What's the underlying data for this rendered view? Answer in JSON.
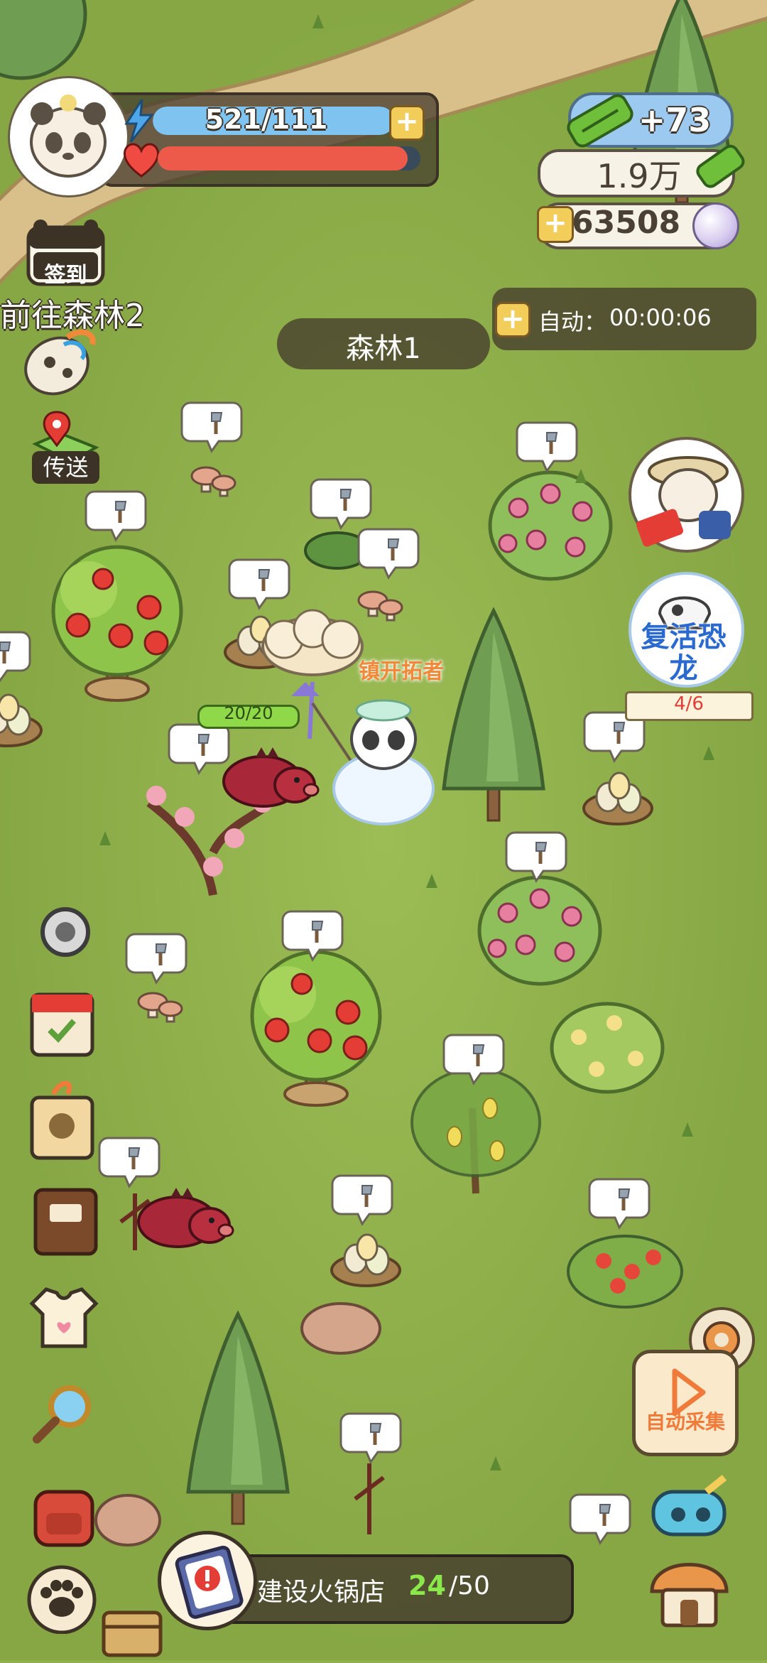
{
  "player": {
    "energy_text": "521/111",
    "energy_fill": 1.0,
    "health_fill": 0.95
  },
  "resources": {
    "bamboo_delta": "+73",
    "bamboo_total": "1.9万",
    "pearls": "63508"
  },
  "left_menu": {
    "signin_label": "签到",
    "goto_forest": "前往森林2",
    "teleport_label": "传送"
  },
  "area": {
    "name": "森林1",
    "auto_label": "自动：",
    "auto_timer": "00:00:06"
  },
  "world": {
    "npc_title": "镇开拓者",
    "player_hp": "20/20"
  },
  "right_menu": {
    "revive_label_line1": "复活恐",
    "revive_label_line2": "龙",
    "revive_progress": "4/6",
    "auto_collect_label": "自动采集"
  },
  "task": {
    "label": "建设火锅店",
    "current": "24",
    "total": "/50"
  },
  "colors": {
    "grass": "#8fb04a",
    "path": "#d9c08a",
    "energy": "#7fc3f0",
    "health": "#ee5a4a",
    "panel": "#463c2d"
  }
}
